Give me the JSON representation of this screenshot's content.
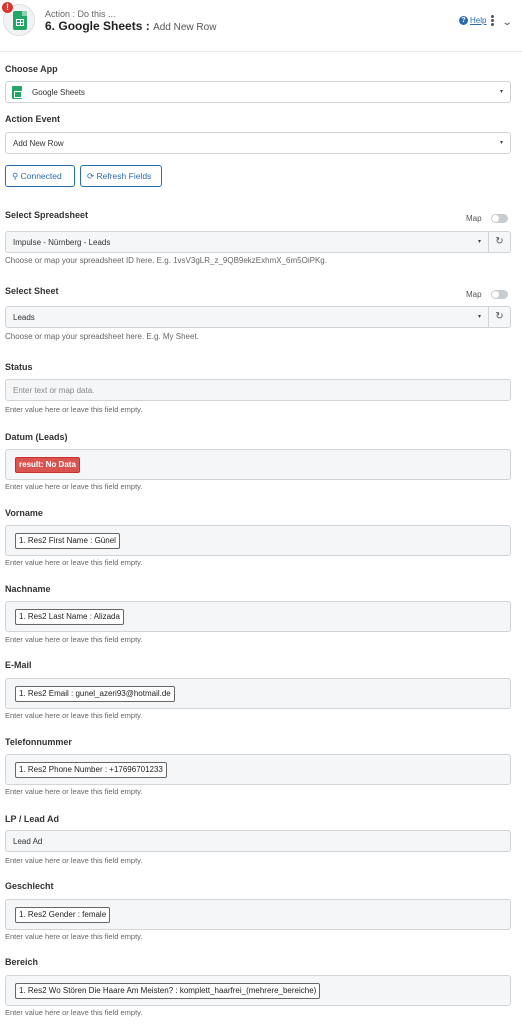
{
  "header": {
    "subtitle": "Action : Do this ...",
    "step": "6.",
    "app": "Google Sheets",
    "separator": ":",
    "event": "Add New Row",
    "help": "Help",
    "alert": "!"
  },
  "choose_app": {
    "label": "Choose App",
    "value": "Google Sheets"
  },
  "action_event": {
    "label": "Action Event",
    "value": "Add New Row"
  },
  "buttons": {
    "connected": "Connected",
    "refresh": "Refresh Fields"
  },
  "spreadsheet": {
    "label": "Select Spreadsheet",
    "map": "Map",
    "value": "Impulse - Nürnberg - Leads",
    "hint": "Choose or map your spreadsheet ID here. E.g. 1vsV3gLR_z_9QB9ekzExhmX_6m5OiPKg."
  },
  "sheet": {
    "label": "Select Sheet",
    "map": "Map",
    "value": "Leads",
    "hint": "Choose or map your spreadsheet here. E.g. My Sheet."
  },
  "status": {
    "label": "Status",
    "placeholder": "Enter text or map data.",
    "hint": "Enter value here or leave this field empty."
  },
  "datum": {
    "label": "Datum (Leads)",
    "value": "result: No Data",
    "hint": "Enter value here or leave this field empty."
  },
  "vorname": {
    "label": "Vorname",
    "value": "1. Res2 First Name : Günel",
    "hint": "Enter value here or leave this field empty."
  },
  "nachname": {
    "label": "Nachname",
    "value": "1. Res2 Last Name : Alizada",
    "hint": "Enter value here or leave this field empty."
  },
  "email": {
    "label": "E-Mail",
    "value": "1. Res2 Email : gunel_azeri93@hotmail.de",
    "hint": "Enter value here or leave this field empty."
  },
  "telefon": {
    "label": "Telefonnummer",
    "value": "1. Res2 Phone Number : +17696701233",
    "hint": "Enter value here or leave this field empty."
  },
  "lp": {
    "label": "LP / Lead Ad",
    "value": "Lead Ad",
    "hint": "Enter value here or leave this field empty."
  },
  "geschlecht": {
    "label": "Geschlecht",
    "value": "1. Res2 Gender : female",
    "hint": "Enter value here or leave this field empty."
  },
  "bereich": {
    "label": "Bereich",
    "value": "1. Res2 Wo Stören Die Haare Am Meisten? : komplett_haarfrei_(mehrere_bereiche)",
    "hint": "Enter value here or leave this field empty."
  },
  "icons": {
    "caret": "▾",
    "refresh": "↻",
    "connected": "plug-icon",
    "refresh_fields": "sync-icon"
  }
}
